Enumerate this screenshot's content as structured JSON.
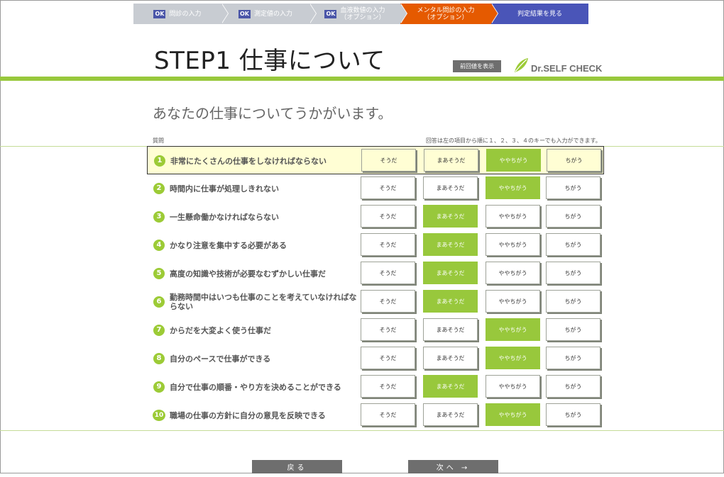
{
  "steps": [
    {
      "ok": "OK",
      "label": "問診の入力"
    },
    {
      "ok": "OK",
      "label": "測定値の入力"
    },
    {
      "ok": "OK",
      "label": "血液数値の入力\n（オプション）"
    },
    {
      "label": "メンタル問診の入力\n（オプション）"
    },
    {
      "label": "判定結果を見る"
    }
  ],
  "header": {
    "title": "STEP1 仕事について",
    "prev_button": "前回値を表示",
    "logo_text": "Dr.SELF CHECK"
  },
  "subtitle": "あなたの仕事についてうかがいます。",
  "column_label": "質問",
  "hint": "回答は左の項目から順に１、２、３、４のキーでも入力ができます。",
  "options": [
    "そうだ",
    "まあそうだ",
    "ややちがう",
    "ちがう"
  ],
  "questions": [
    {
      "num": "1",
      "text": "非常にたくさんの仕事をしなければならない",
      "selected": 2
    },
    {
      "num": "2",
      "text": "時間内に仕事が処理しきれない",
      "selected": 2
    },
    {
      "num": "3",
      "text": "一生懸命働かなければならない",
      "selected": 1
    },
    {
      "num": "4",
      "text": "かなり注意を集中する必要がある",
      "selected": 1
    },
    {
      "num": "5",
      "text": "高度の知識や技術が必要なむずかしい仕事だ",
      "selected": 1
    },
    {
      "num": "6",
      "text": "勤務時間中はいつも仕事のことを考えていなければならない",
      "selected": 1
    },
    {
      "num": "7",
      "text": "からだを大変よく使う仕事だ",
      "selected": 2
    },
    {
      "num": "8",
      "text": "自分のペースで仕事ができる",
      "selected": 2
    },
    {
      "num": "9",
      "text": "自分で仕事の順番・やり方を決めることができる",
      "selected": 1
    },
    {
      "num": "10",
      "text": "職場の仕事の方針に自分の意見を反映できる",
      "selected": 2
    }
  ],
  "nav": {
    "back": "戻る",
    "next": "次へ →"
  },
  "colors": {
    "accent": "#98c83c",
    "current_step": "#e55a00",
    "final_step": "#4a55b8",
    "done_step": "#c8ccd2"
  }
}
